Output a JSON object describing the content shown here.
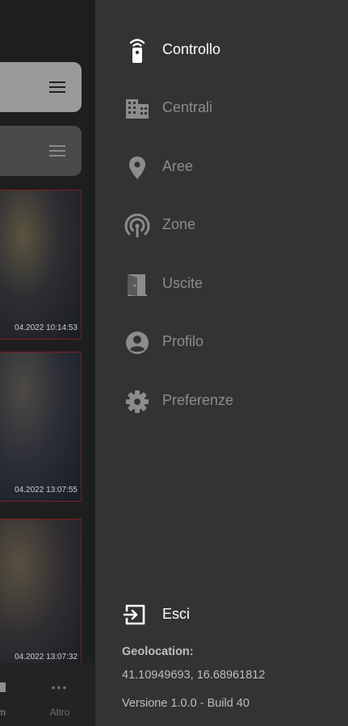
{
  "background_app": {
    "thumbnails": [
      {
        "timestamp": "04.2022 10:14:53"
      },
      {
        "timestamp": "04.2022 13:07:55"
      },
      {
        "timestamp": "04.2022 13:07:32"
      }
    ],
    "tabbar": {
      "cam_label": "m",
      "more_label": "Altro",
      "more_icon": "•••"
    }
  },
  "drawer": {
    "items": [
      {
        "label": "Controllo",
        "icon": "remote-control-icon",
        "active": true
      },
      {
        "label": "Centrali",
        "icon": "building-icon",
        "active": false
      },
      {
        "label": "Aree",
        "icon": "location-pin-icon",
        "active": false
      },
      {
        "label": "Zone",
        "icon": "radar-icon",
        "active": false
      },
      {
        "label": "Uscite",
        "icon": "door-icon",
        "active": false
      },
      {
        "label": "Profilo",
        "icon": "account-circle-icon",
        "active": false
      },
      {
        "label": "Preferenze",
        "icon": "gear-icon",
        "active": false
      }
    ],
    "logout_label": "Esci",
    "geolocation_title": "Geolocation:",
    "geolocation_value": "41.10949693, 16.68961812",
    "version": "Versione 1.0.0 - Build 40"
  },
  "colors": {
    "drawer_bg": "#333333",
    "active_text": "#ffffff",
    "inactive_text": "#8c8c8c"
  }
}
